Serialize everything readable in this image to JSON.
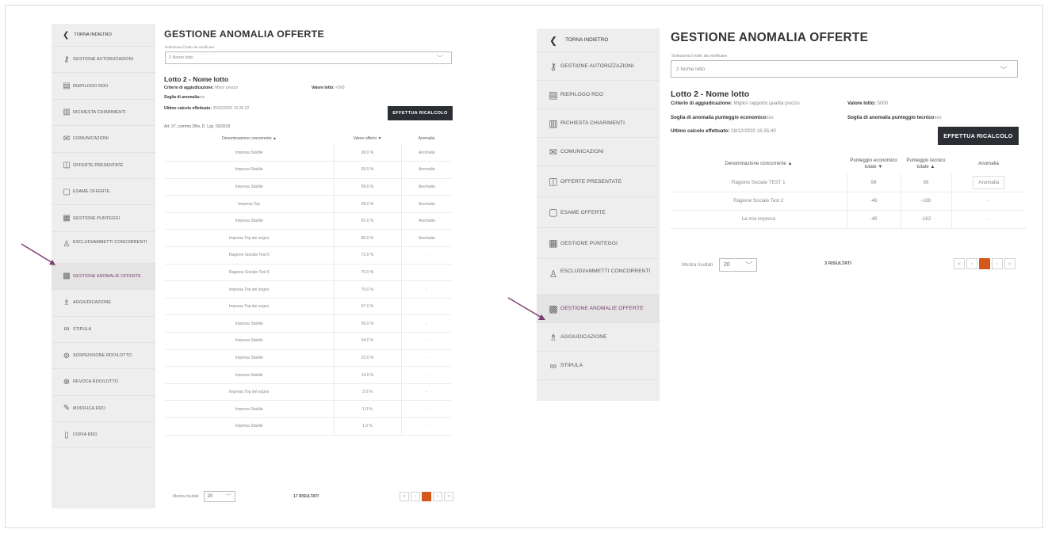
{
  "panel1": {
    "sidebar": {
      "back": "TORNA INDIETRO",
      "items": [
        {
          "label": "GESTIONE AUTORIZZAZIONI",
          "icon": "users-key-icon"
        },
        {
          "label": "RIEPILOGO RDO",
          "icon": "document-list-icon"
        },
        {
          "label": "RICHIESTA CHIARIMENTI",
          "icon": "document-question-icon"
        },
        {
          "label": "COMUNICAZIONI",
          "icon": "chat-icon"
        },
        {
          "label": "OFFERTE PRESENTATE",
          "icon": "offer-document-icon"
        },
        {
          "label": "ESAME OFFERTE",
          "icon": "document-check-icon"
        },
        {
          "label": "GESTIONE PUNTEGGI",
          "icon": "score-table-icon"
        },
        {
          "label": "ESCLUDI/AMMETTI CONCORRENTI",
          "icon": "user-exclude-icon"
        },
        {
          "label": "GESTIONE ANOMALIE OFFERTE",
          "icon": "anomaly-grid-icon",
          "active": true
        },
        {
          "label": "AGGIUDICAZIONE",
          "icon": "award-user-icon"
        },
        {
          "label": "STIPULA",
          "icon": "handshake-icon"
        },
        {
          "label": "SOSPENSIONE RDO/LOTTO",
          "icon": "pause-circle-icon"
        },
        {
          "label": "REVOCA RDO/LOTTO",
          "icon": "revoke-circle-icon"
        },
        {
          "label": "MODIFICA RDO",
          "icon": "edit-icon"
        },
        {
          "label": "COPIA RDO",
          "icon": "copy-document-icon"
        }
      ]
    },
    "title": "GESTIONE ANOMALIA OFFERTE",
    "select_label": "Seleziona il lotto da verificare",
    "select_value": "2 Nome lotto",
    "lot_title": "Lotto 2 - Nome lotto",
    "criterio_label": "Criterio di aggiudicazione:",
    "criterio_value": "Minor prezzo",
    "valore_label": "Valore lotto:",
    "valore_value": "<500",
    "soglia_label": "Soglia di anomalia",
    "soglia_value": "xxx",
    "calcolo_label": "Ultimo calcolo effettuato:",
    "calcolo_value": "25/02/2021 15.20.22",
    "article": "Art. 97, comma 2Bis, D. Lgs. 50/2019",
    "button": "EFFETTUA RICALCOLO",
    "columns": [
      "Denominazione concorrente ▲",
      "Valore offerto ▼",
      "Anomalia"
    ],
    "rows": [
      [
        "Impresa Stabile",
        "99.0 %",
        "Anomalia"
      ],
      [
        "Impresa Stabile",
        "99.0 %",
        "Anomalia"
      ],
      [
        "Impresa Stabile",
        "99.0 %",
        "Anomalia"
      ],
      [
        "Impresa Top",
        "98.0 %",
        "Anomalia"
      ],
      [
        "Impresa Stabile",
        "81.0 %",
        "Anomalia"
      ],
      [
        "Impresa Top dei sogno",
        "80.0 %",
        "Anomalia"
      ],
      [
        "Ragione Sociale Test 6",
        "72.0 %",
        "-"
      ],
      [
        "Ragione Sociale Test 6",
        "70.0 %",
        "-"
      ],
      [
        "Impresa Top del sogno",
        "70.0 %",
        "-"
      ],
      [
        "Impresa Top dei sogno",
        "67.0 %",
        "-"
      ],
      [
        "Impresa Stabile",
        "56.0 %",
        "-"
      ],
      [
        "Impresa Stabile",
        "44.0 %",
        "-"
      ],
      [
        "Impresa Stabile",
        "23.0 %",
        "-"
      ],
      [
        "Impresa Stabile",
        "14.0 %",
        "-"
      ],
      [
        "Impresa Top del sogno",
        "2.0 %",
        "-"
      ],
      [
        "Impresa Stabile",
        "1.0 %",
        "-"
      ],
      [
        "Impresa Stabile",
        "1.0 %",
        "-"
      ]
    ],
    "pager_label": "Mostra risultati",
    "pager_value": "20",
    "results": "17 RISULTATI",
    "pages": [
      "«",
      "‹",
      "1",
      "›",
      "»"
    ]
  },
  "panel2": {
    "sidebar": {
      "back": "TORNA INDIETRO",
      "items": [
        {
          "label": "GESTIONE AUTORIZZAZIONI",
          "icon": "users-key-icon"
        },
        {
          "label": "RIEPILOGO RDO",
          "icon": "document-list-icon"
        },
        {
          "label": "RICHIESTA CHIARIMENTI",
          "icon": "document-question-icon"
        },
        {
          "label": "COMUNICAZIONI",
          "icon": "chat-icon"
        },
        {
          "label": "OFFERTE PRESENTATE",
          "icon": "offer-document-icon"
        },
        {
          "label": "ESAME OFFERTE",
          "icon": "document-check-icon"
        },
        {
          "label": "GESTIONE PUNTEGGI",
          "icon": "score-table-icon"
        },
        {
          "label": "ESCLUDI/AMMETTI CONCORRENTI",
          "icon": "user-exclude-icon"
        },
        {
          "label": "GESTIONE ANOMALIE OFFERTE",
          "icon": "anomaly-grid-icon",
          "active": true
        },
        {
          "label": "AGGIUDICAZIONE",
          "icon": "award-user-icon"
        },
        {
          "label": "STIPULA",
          "icon": "handshake-icon"
        }
      ]
    },
    "title": "GESTIONE ANOMALIA OFFERTE",
    "select_label": "Seleziona il lotto da verificare",
    "select_value": "2 Nome lotto",
    "lot_title": "Lotto 2 - Nome lotto",
    "criterio_label": "Criterio di aggiudicazione:",
    "criterio_value": "Miglior rapporto qualità prezzo",
    "valore_label": "Valore lotto:",
    "valore_value": "5000",
    "soglia_econ_label": "Soglia di anomalia punteggio economico",
    "soglia_econ_value": "xxx",
    "soglia_tec_label": "Soglia di anomalia punteggio tecnico",
    "soglia_tec_value": "xxx",
    "calcolo_label": "Ultimo calcolo effettuato:",
    "calcolo_value": "28/12/2020 16:35:40",
    "button": "EFFETTUA RICALCOLO",
    "columns": [
      "Denominazione concorrente ▲",
      "Punteggio economico totale ▼",
      "Punteggio tecnico totale ▲",
      "Anomalia"
    ],
    "rows": [
      [
        "Ragione Sociale TEST 1",
        "99",
        "99",
        "Anomalia"
      ],
      [
        "Ragione Sociale Test 2",
        "-46",
        "-188",
        "-"
      ],
      [
        "La mia impresa",
        "-49",
        "-182",
        "-"
      ]
    ],
    "pager_label": "Mostra risultati",
    "pager_value": "20",
    "results": "3 RISULTATI",
    "pages": [
      "«",
      "‹",
      "1",
      "›",
      "»"
    ]
  },
  "colors": {
    "accent": "#7b3b70",
    "button": "#2b2f33",
    "page_active": "#d4581c",
    "arrow": "#7b3b70"
  }
}
